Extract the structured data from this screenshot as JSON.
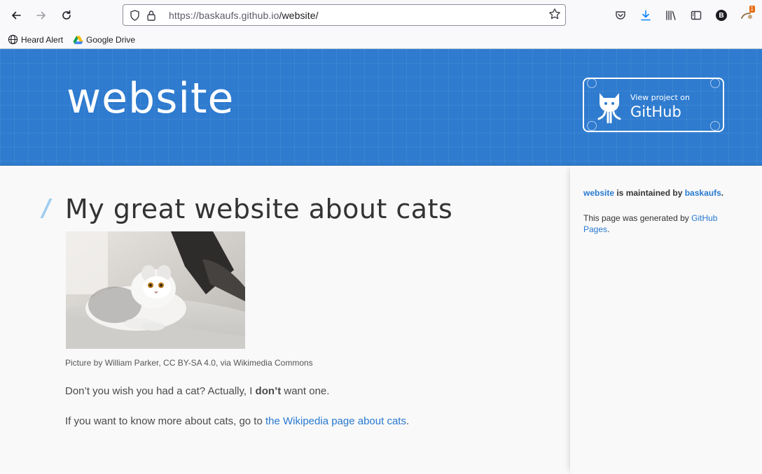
{
  "browser": {
    "url_host": "https://baskaufs.github.io",
    "url_path": "/website/",
    "bookmarks": [
      {
        "label": "Heard Alert",
        "icon": "globe-icon"
      },
      {
        "label": "Google Drive",
        "icon": "google-drive-icon"
      }
    ],
    "profile_initial": "B",
    "extension_badge": "1"
  },
  "header": {
    "site_title": "website",
    "github_button": {
      "small": "View project on",
      "big": "GitHub"
    }
  },
  "main": {
    "heading": "My great website about cats",
    "caption": "Picture by William Parker, CC BY-SA 4.0, via Wikimedia Commons",
    "para1_before": "Don’t you wish you had a cat? Actually, I ",
    "para1_bold": "don’t",
    "para1_after": " want one.",
    "para2_before": "If you want to know more about cats, go to ",
    "para2_link": "the Wikipedia page about cats",
    "para2_after": "."
  },
  "sidebar": {
    "project_link": "website",
    "maintained_text": " is maintained by ",
    "owner_link": "baskaufs",
    "period": ".",
    "generated_text": "This page was generated by ",
    "generated_link": "GitHub Pages",
    "generated_period": "."
  },
  "colors": {
    "header_blue": "#2e7bcf",
    "link": "#2879d0"
  }
}
